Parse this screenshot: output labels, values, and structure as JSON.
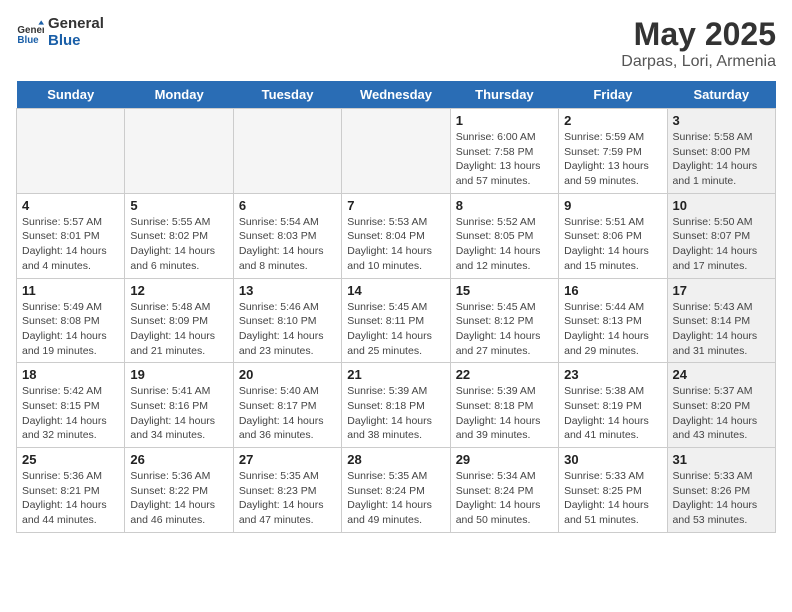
{
  "header": {
    "logo_general": "General",
    "logo_blue": "Blue",
    "month": "May 2025",
    "location": "Darpas, Lori, Armenia"
  },
  "days_of_week": [
    "Sunday",
    "Monday",
    "Tuesday",
    "Wednesday",
    "Thursday",
    "Friday",
    "Saturday"
  ],
  "weeks": [
    [
      {
        "day": "",
        "info": "",
        "empty": true
      },
      {
        "day": "",
        "info": "",
        "empty": true
      },
      {
        "day": "",
        "info": "",
        "empty": true
      },
      {
        "day": "",
        "info": "",
        "empty": true
      },
      {
        "day": "1",
        "info": "Sunrise: 6:00 AM\nSunset: 7:58 PM\nDaylight: 13 hours\nand 57 minutes."
      },
      {
        "day": "2",
        "info": "Sunrise: 5:59 AM\nSunset: 7:59 PM\nDaylight: 13 hours\nand 59 minutes."
      },
      {
        "day": "3",
        "info": "Sunrise: 5:58 AM\nSunset: 8:00 PM\nDaylight: 14 hours\nand 1 minute.",
        "shaded": true
      }
    ],
    [
      {
        "day": "4",
        "info": "Sunrise: 5:57 AM\nSunset: 8:01 PM\nDaylight: 14 hours\nand 4 minutes."
      },
      {
        "day": "5",
        "info": "Sunrise: 5:55 AM\nSunset: 8:02 PM\nDaylight: 14 hours\nand 6 minutes."
      },
      {
        "day": "6",
        "info": "Sunrise: 5:54 AM\nSunset: 8:03 PM\nDaylight: 14 hours\nand 8 minutes."
      },
      {
        "day": "7",
        "info": "Sunrise: 5:53 AM\nSunset: 8:04 PM\nDaylight: 14 hours\nand 10 minutes."
      },
      {
        "day": "8",
        "info": "Sunrise: 5:52 AM\nSunset: 8:05 PM\nDaylight: 14 hours\nand 12 minutes."
      },
      {
        "day": "9",
        "info": "Sunrise: 5:51 AM\nSunset: 8:06 PM\nDaylight: 14 hours\nand 15 minutes."
      },
      {
        "day": "10",
        "info": "Sunrise: 5:50 AM\nSunset: 8:07 PM\nDaylight: 14 hours\nand 17 minutes.",
        "shaded": true
      }
    ],
    [
      {
        "day": "11",
        "info": "Sunrise: 5:49 AM\nSunset: 8:08 PM\nDaylight: 14 hours\nand 19 minutes."
      },
      {
        "day": "12",
        "info": "Sunrise: 5:48 AM\nSunset: 8:09 PM\nDaylight: 14 hours\nand 21 minutes."
      },
      {
        "day": "13",
        "info": "Sunrise: 5:46 AM\nSunset: 8:10 PM\nDaylight: 14 hours\nand 23 minutes."
      },
      {
        "day": "14",
        "info": "Sunrise: 5:45 AM\nSunset: 8:11 PM\nDaylight: 14 hours\nand 25 minutes."
      },
      {
        "day": "15",
        "info": "Sunrise: 5:45 AM\nSunset: 8:12 PM\nDaylight: 14 hours\nand 27 minutes."
      },
      {
        "day": "16",
        "info": "Sunrise: 5:44 AM\nSunset: 8:13 PM\nDaylight: 14 hours\nand 29 minutes."
      },
      {
        "day": "17",
        "info": "Sunrise: 5:43 AM\nSunset: 8:14 PM\nDaylight: 14 hours\nand 31 minutes.",
        "shaded": true
      }
    ],
    [
      {
        "day": "18",
        "info": "Sunrise: 5:42 AM\nSunset: 8:15 PM\nDaylight: 14 hours\nand 32 minutes."
      },
      {
        "day": "19",
        "info": "Sunrise: 5:41 AM\nSunset: 8:16 PM\nDaylight: 14 hours\nand 34 minutes."
      },
      {
        "day": "20",
        "info": "Sunrise: 5:40 AM\nSunset: 8:17 PM\nDaylight: 14 hours\nand 36 minutes."
      },
      {
        "day": "21",
        "info": "Sunrise: 5:39 AM\nSunset: 8:18 PM\nDaylight: 14 hours\nand 38 minutes."
      },
      {
        "day": "22",
        "info": "Sunrise: 5:39 AM\nSunset: 8:18 PM\nDaylight: 14 hours\nand 39 minutes."
      },
      {
        "day": "23",
        "info": "Sunrise: 5:38 AM\nSunset: 8:19 PM\nDaylight: 14 hours\nand 41 minutes."
      },
      {
        "day": "24",
        "info": "Sunrise: 5:37 AM\nSunset: 8:20 PM\nDaylight: 14 hours\nand 43 minutes.",
        "shaded": true
      }
    ],
    [
      {
        "day": "25",
        "info": "Sunrise: 5:36 AM\nSunset: 8:21 PM\nDaylight: 14 hours\nand 44 minutes."
      },
      {
        "day": "26",
        "info": "Sunrise: 5:36 AM\nSunset: 8:22 PM\nDaylight: 14 hours\nand 46 minutes."
      },
      {
        "day": "27",
        "info": "Sunrise: 5:35 AM\nSunset: 8:23 PM\nDaylight: 14 hours\nand 47 minutes."
      },
      {
        "day": "28",
        "info": "Sunrise: 5:35 AM\nSunset: 8:24 PM\nDaylight: 14 hours\nand 49 minutes."
      },
      {
        "day": "29",
        "info": "Sunrise: 5:34 AM\nSunset: 8:24 PM\nDaylight: 14 hours\nand 50 minutes."
      },
      {
        "day": "30",
        "info": "Sunrise: 5:33 AM\nSunset: 8:25 PM\nDaylight: 14 hours\nand 51 minutes."
      },
      {
        "day": "31",
        "info": "Sunrise: 5:33 AM\nSunset: 8:26 PM\nDaylight: 14 hours\nand 53 minutes.",
        "shaded": true
      }
    ]
  ]
}
